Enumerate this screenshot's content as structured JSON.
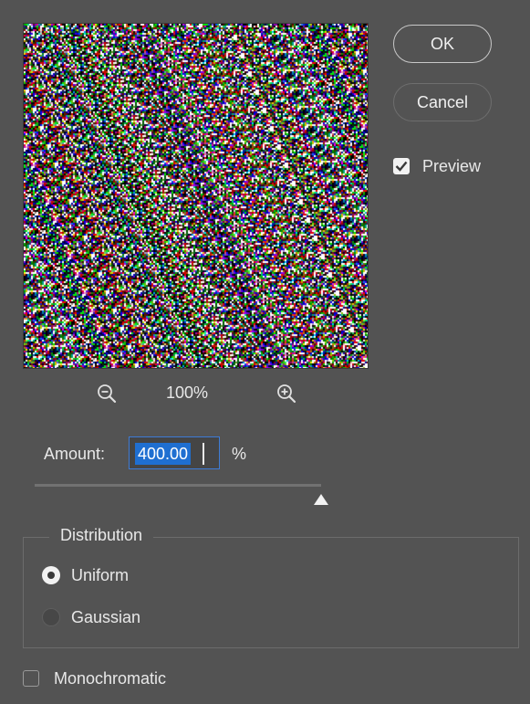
{
  "buttons": {
    "ok_label": "OK",
    "cancel_label": "Cancel"
  },
  "preview": {
    "label": "Preview",
    "checked": true,
    "zoom_level": "100%"
  },
  "amount": {
    "label": "Amount:",
    "value": "400.00",
    "unit": "%",
    "slider_fraction": 1.0
  },
  "distribution": {
    "legend": "Distribution",
    "options": [
      {
        "label": "Uniform",
        "selected": true
      },
      {
        "label": "Gaussian",
        "selected": false
      }
    ]
  },
  "monochromatic": {
    "label": "Monochromatic",
    "checked": false
  },
  "colors": {
    "background": "#535353",
    "accent": "#1f6fd1",
    "text": "#e8e8e8"
  },
  "icons": {
    "zoom_out": "zoom-out-icon",
    "zoom_in": "zoom-in-icon",
    "check": "check-icon"
  }
}
